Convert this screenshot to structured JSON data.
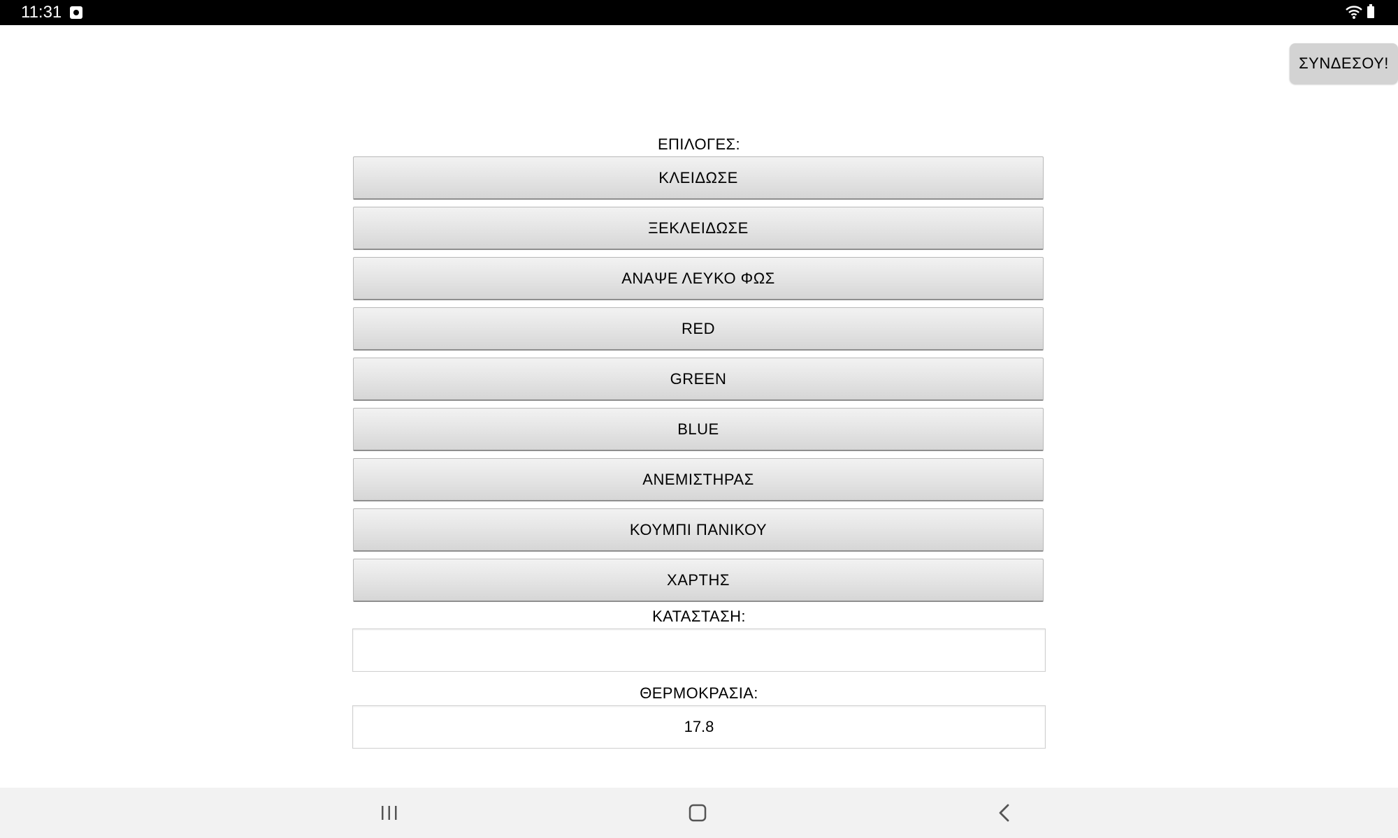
{
  "status_bar": {
    "time": "11:31"
  },
  "header": {
    "connect_label": "ΣΥΝΔΕΣΟΥ!"
  },
  "options": {
    "label": "ΕΠΙΛΟΓΕΣ:",
    "buttons": [
      {
        "label": "ΚΛΕΙΔΩΣΕ"
      },
      {
        "label": "ΞΕΚΛΕΙΔΩΣΕ"
      },
      {
        "label": "ΑΝΑΨΕ ΛΕΥΚΟ ΦΩΣ"
      },
      {
        "label": "RED"
      },
      {
        "label": "GREEN"
      },
      {
        "label": "BLUE"
      },
      {
        "label": "ΑΝΕΜΙΣΤΗΡΑΣ"
      },
      {
        "label": "ΚΟΥΜΠΙ ΠΑΝΙΚΟΥ"
      },
      {
        "label": "ΧΑΡΤΗΣ"
      }
    ]
  },
  "status": {
    "label": "ΚΑΤΑΣΤΑΣΗ:",
    "value": ""
  },
  "temperature": {
    "label": "ΘΕΡΜΟΚΡΑΣΙΑ:",
    "value": "17.8"
  },
  "nav": {
    "icons": [
      "recents-icon",
      "home-icon",
      "back-icon"
    ]
  },
  "colors": {
    "status_bar": "#000000",
    "button_face": "#e6e6e6",
    "connect_button": "#d3d3d3",
    "nav_bar": "#f2f2f2"
  }
}
